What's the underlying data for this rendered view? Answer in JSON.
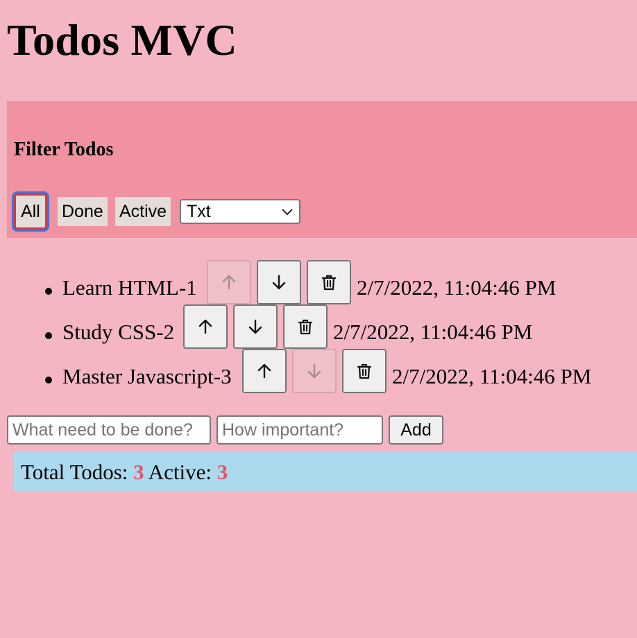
{
  "app": {
    "title": "Todos MVC"
  },
  "filter": {
    "title": "Filter Todos",
    "buttons": [
      {
        "label": "All",
        "selected": true
      },
      {
        "label": "Done",
        "selected": false
      },
      {
        "label": "Active",
        "selected": false
      }
    ],
    "sort_select": {
      "value": "Txt"
    }
  },
  "todos": [
    {
      "text": "Learn HTML-1",
      "date": "2/7/2022, 11:04:46 PM",
      "up_enabled": false,
      "down_enabled": true
    },
    {
      "text": "Study CSS-2",
      "date": "2/7/2022, 11:04:46 PM",
      "up_enabled": true,
      "down_enabled": true
    },
    {
      "text": "Master Javascript-3",
      "date": "2/7/2022, 11:04:46 PM",
      "up_enabled": true,
      "down_enabled": false
    }
  ],
  "new_todo": {
    "text_placeholder": "What need to be done?",
    "importance_placeholder": "How important?",
    "add_label": "Add"
  },
  "stats": {
    "total_label": "Total Todos: ",
    "total_value": "3",
    "active_label": " Active: ",
    "active_value": "3"
  },
  "colors": {
    "page_background": "#f4b6c2",
    "filter_panel": "#f0929f",
    "stats_bar": "#abd9ee",
    "stat_number": "#e25668"
  },
  "icons": {
    "up": "arrow-up-icon",
    "down": "arrow-down-icon",
    "delete": "trash-icon",
    "select": "chevron-down-icon"
  }
}
